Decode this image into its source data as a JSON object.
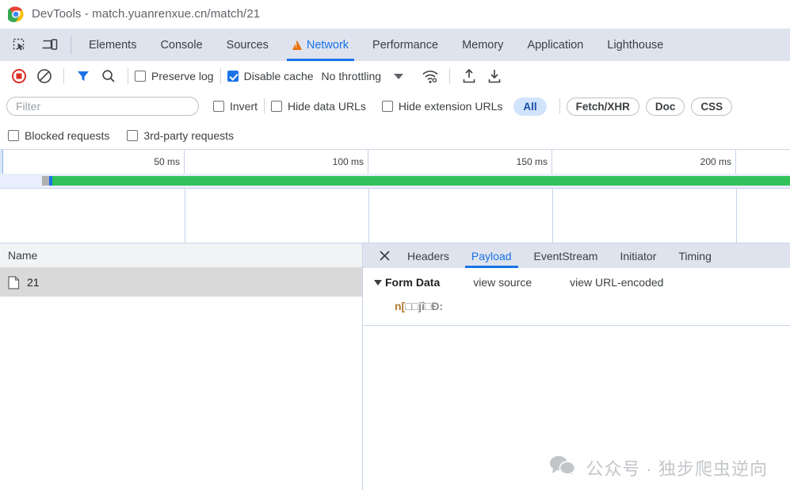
{
  "window": {
    "title": "DevTools - match.yuanrenxue.cn/match/21",
    "logo_icon": "chrome-logo-icon"
  },
  "tabstrip": {
    "tools": [
      {
        "icon": "inspect-element-icon"
      },
      {
        "icon": "device-toolbar-icon"
      }
    ],
    "tabs": [
      {
        "label": "Elements",
        "active": false,
        "warning": false
      },
      {
        "label": "Console",
        "active": false,
        "warning": false
      },
      {
        "label": "Sources",
        "active": false,
        "warning": false
      },
      {
        "label": "Network",
        "active": true,
        "warning": true
      },
      {
        "label": "Performance",
        "active": false,
        "warning": false
      },
      {
        "label": "Memory",
        "active": false,
        "warning": false
      },
      {
        "label": "Application",
        "active": false,
        "warning": false
      },
      {
        "label": "Lighthouse",
        "active": false,
        "warning": false
      }
    ]
  },
  "network_toolbar": {
    "record_icon": "record-stop-icon",
    "clear_icon": "clear-icon",
    "filter_icon": "filter-funnel-icon",
    "search_icon": "search-icon",
    "preserve_log_label": "Preserve log",
    "preserve_log_checked": false,
    "disable_cache_label": "Disable cache",
    "disable_cache_checked": true,
    "throttling_label": "No throttling",
    "throttling_caret_icon": "chevron-down-icon",
    "network_conditions_icon": "wifi-settings-icon",
    "import_icon": "import-har-icon",
    "export_icon": "export-har-icon"
  },
  "filter_row": {
    "filter_placeholder": "Filter",
    "filter_value": "",
    "invert_label": "Invert",
    "invert_checked": false,
    "hide_data_urls_label": "Hide data URLs",
    "hide_data_urls_checked": false,
    "hide_extension_urls_label": "Hide extension URLs",
    "hide_extension_urls_checked": false,
    "type_chips": [
      {
        "label": "All",
        "selected": true
      },
      {
        "label": "Fetch/XHR",
        "selected": false
      },
      {
        "label": "Doc",
        "selected": false
      },
      {
        "label": "CSS",
        "selected": false
      }
    ]
  },
  "blocked_row": {
    "blocked_requests_label": "Blocked requests",
    "blocked_requests_checked": false,
    "third_party_label": "3rd-party requests",
    "third_party_checked": false
  },
  "overview": {
    "ticks": [
      "50 ms",
      "100 ms",
      "150 ms",
      "200 ms"
    ],
    "bar": {
      "wait_color": "#b0b0b0",
      "ttfb_color": "#1a73e8",
      "download_color": "#32c25b"
    }
  },
  "requests_table": {
    "columns": [
      "Name"
    ],
    "rows": [
      {
        "name": "21",
        "icon": "document-icon",
        "selected": true
      }
    ]
  },
  "detail_panel": {
    "close_icon": "close-icon",
    "tabs": [
      {
        "label": "Headers",
        "active": false
      },
      {
        "label": "Payload",
        "active": true
      },
      {
        "label": "EventStream",
        "active": false
      },
      {
        "label": "Initiator",
        "active": false
      },
      {
        "label": "Timing",
        "active": false
      }
    ],
    "form_data": {
      "section_title": "Form Data",
      "expand_icon": "triangle-down-icon",
      "view_source_label": "view source",
      "view_url_encoded_label": "view URL-encoded",
      "entries": [
        {
          "key_prefix": "n[",
          "key_body": "□□jî□Ð",
          "key_suffix": ":",
          "value": ""
        }
      ]
    }
  },
  "watermark": {
    "icon": "wechat-icon",
    "text": "公众号 · 独步爬虫逆向"
  },
  "colors": {
    "accent": "#1a73e8",
    "tab_bg": "#dee3ed",
    "selected_row": "#d9d9d9",
    "chip_selected_bg": "#d2e3fc",
    "warning": "#e8710a",
    "record_red": "#d93025",
    "download_green": "#32c25b"
  }
}
